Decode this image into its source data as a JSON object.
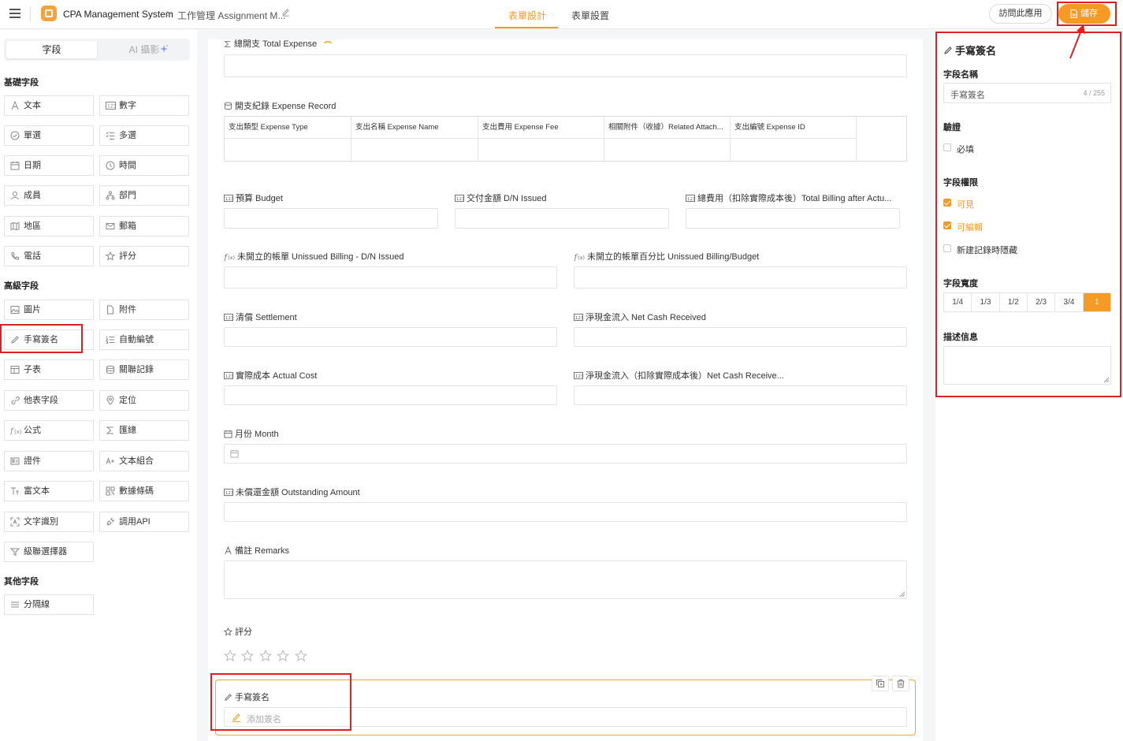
{
  "header": {
    "app_name": "CPA Management System",
    "breadcrumb_sep": ">",
    "form_name": "工作管理 Assignment M...",
    "tabs": [
      "表單設計",
      "表單設置"
    ],
    "visit_label": "訪問此應用",
    "save_label": "儲存",
    "accent_color": "#f59a23"
  },
  "left": {
    "tabs": [
      "字段",
      "AI 攝影"
    ],
    "groups": [
      {
        "title": "基礎字段",
        "items": [
          "文本",
          "數字",
          "單選",
          "多選",
          "日期",
          "時間",
          "成員",
          "部門",
          "地區",
          "郵箱",
          "電話",
          "評分"
        ]
      },
      {
        "title": "高級字段",
        "items": [
          "圖片",
          "附件",
          "手寫簽名",
          "自動編號",
          "子表",
          "關聯記錄",
          "他表字段",
          "定位",
          "公式",
          "匯總",
          "證件",
          "文本組合",
          "富文本",
          "數據條碼",
          "文字識別",
          "調用API",
          "級聯選擇器"
        ]
      },
      {
        "title": "其他字段",
        "items": [
          "分隔線"
        ]
      }
    ]
  },
  "canvas": {
    "total_expense": "總開支 Total Expense",
    "expense_record": "開支紀錄 Expense Record",
    "subtable_headers": [
      "支出類型 Expense Type",
      "支出名稱 Expense Name",
      "支出費用 Expense Fee",
      "相關附件（收據）Related Attach...",
      "支出編號 Expense ID"
    ],
    "budget": "預算 Budget",
    "dn_issued": "交付金額 D/N Issued",
    "total_billing": "總費用（扣除實際成本後）Total Billing after Actu...",
    "unissued_billing": "未開立的帳單 Unissued Billing - D/N Issued",
    "unissued_pct": "未開立的帳單百分比 Unissued Billing/Budget",
    "settlement": "清償 Settlement",
    "net_cash": "淨現金流入 Net Cash Received",
    "actual_cost": "實際成本 Actual Cost",
    "net_cash_after": "淨現金流入（扣除實際成本後）Net Cash Receive...",
    "month": "月份 Month",
    "outstanding": "未償還金額 Outstanding Amount",
    "remarks": "備註 Remarks",
    "rating": "評分",
    "rating_stars": 5,
    "signature": "手寫簽名",
    "signature_placeholder": "添加簽名"
  },
  "right": {
    "title": "手寫簽名",
    "field_name_label": "字段名稱",
    "field_name_value": "手寫簽名",
    "field_name_count": "4 / 255",
    "validation_label": "驗證",
    "required_label": "必填",
    "permission_label": "字段權限",
    "visible_label": "可見",
    "editable_label": "可編輯",
    "hide_label": "新建記錄時隱藏",
    "width_label": "字段寬度",
    "width_options": [
      "1/4",
      "1/3",
      "1/2",
      "2/3",
      "3/4",
      "1"
    ],
    "width_selected": "1",
    "desc_label": "描述信息"
  }
}
